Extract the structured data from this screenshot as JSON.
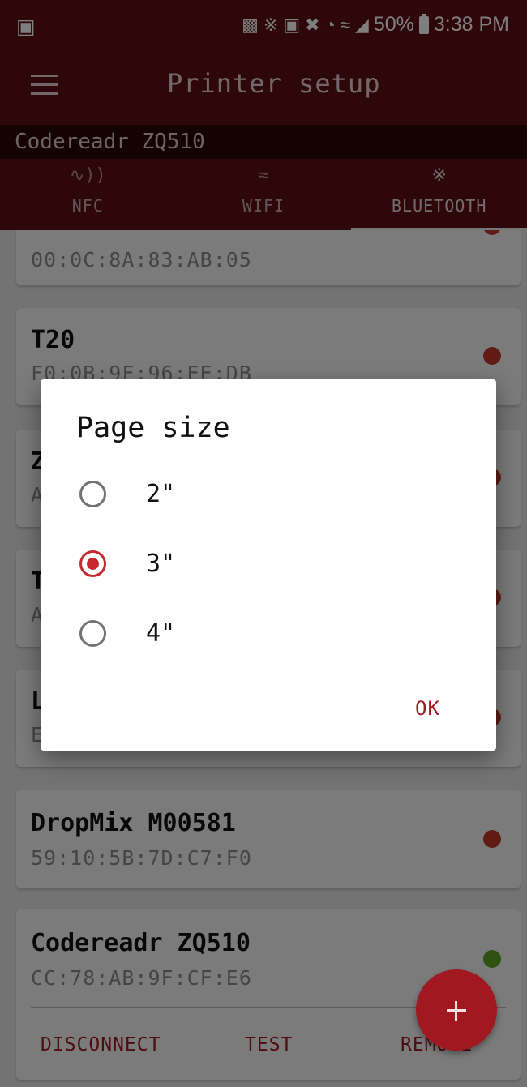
{
  "status_bar": {
    "left_icon": "gallery-icon",
    "icons": [
      "battery-saver-icon",
      "bluetooth-icon",
      "nfc-icon",
      "mute-icon",
      "alarm-icon",
      "wifi-icon",
      "signal-icon"
    ],
    "battery": "50%",
    "time": "3:38 PM"
  },
  "toolbar": {
    "title": "Printer setup",
    "menu_icon": "menu-icon"
  },
  "connected_printer": "Codereadr ZQ510",
  "tabs": [
    {
      "label": "NFC",
      "icon": "nfc-icon",
      "active": false
    },
    {
      "label": "WIFI",
      "icon": "wifi-icon",
      "active": false
    },
    {
      "label": "BLUETOOTH",
      "icon": "bluetooth-icon",
      "active": true
    }
  ],
  "devices": [
    {
      "name": "",
      "mac": "00:0C:8A:83:AB:05",
      "status": "red"
    },
    {
      "name": "T20",
      "mac": "F0:0B:9F:96:EE:DB",
      "status": "red"
    },
    {
      "name": "Z",
      "mac": "A",
      "status": "red"
    },
    {
      "name": "T",
      "mac": "A",
      "status": "red"
    },
    {
      "name": "L",
      "mac": "E",
      "status": "red"
    },
    {
      "name": "DropMix M00581",
      "mac": "59:10:5B:7D:C7:F0",
      "status": "red"
    },
    {
      "name": "Codereadr ZQ510",
      "mac": "CC:78:AB:9F:CF:E6",
      "status": "green"
    }
  ],
  "card_actions": {
    "disconnect": "DISCONNECT",
    "test": "TEST",
    "remove": "REMOVE"
  },
  "fab": {
    "icon": "plus-icon",
    "label": "+"
  },
  "dialog": {
    "title": "Page size",
    "options": [
      {
        "label": "2\"",
        "selected": false
      },
      {
        "label": "3\"",
        "selected": true
      },
      {
        "label": "4\"",
        "selected": false
      }
    ],
    "ok": "OK"
  },
  "colors": {
    "primary_dark": "#5c0f14",
    "accent": "#c62a2f",
    "status_red": "#c0362a",
    "status_green": "#5fa324"
  }
}
